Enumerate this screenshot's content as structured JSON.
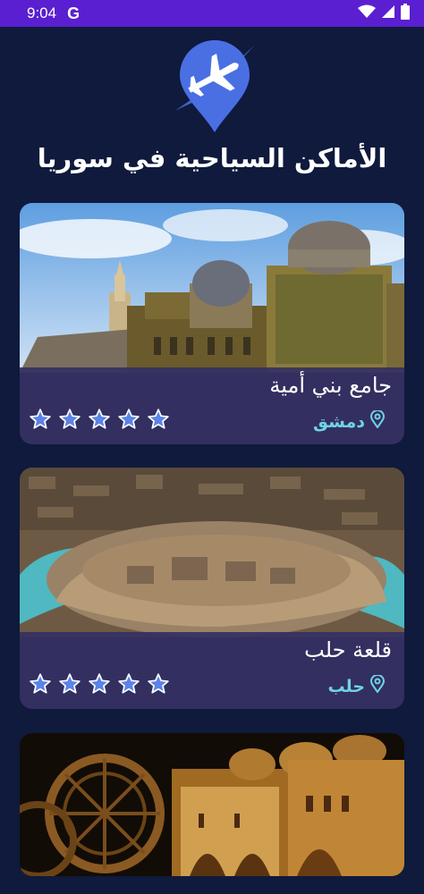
{
  "status_bar": {
    "time": "9:04",
    "g_label": "G"
  },
  "header": {
    "title": "الأماكن السياحية في سوريا"
  },
  "places": [
    {
      "name": "جامع بني أمية",
      "city": "دمشق",
      "rating": 5
    },
    {
      "name": "قلعة حلب",
      "city": "حلب",
      "rating": 5
    },
    {
      "name": "",
      "city": "",
      "rating": null
    }
  ],
  "colors": {
    "status_bar": "#5a1fd1",
    "background": "#0f1a3c",
    "card_panel": "#343062",
    "accent_cyan": "#6fd3e3",
    "star_fill": "#5b83e8",
    "logo_blue": "#4a6fe3"
  },
  "icons": [
    "signal-icon",
    "wifi-icon",
    "battery-icon",
    "plane-location-logo",
    "location-pin-icon",
    "star-icon"
  ]
}
